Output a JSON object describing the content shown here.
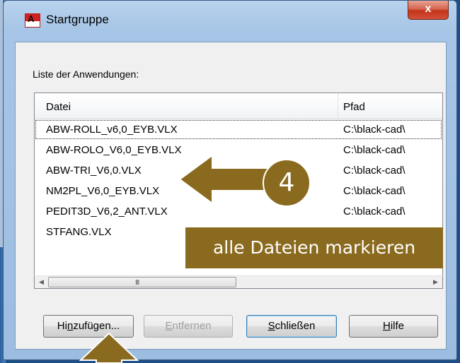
{
  "window": {
    "title": "Startgruppe",
    "app_icon_letter": "A",
    "close_label": "x"
  },
  "list_label": "Liste der Anwendungen:",
  "listview": {
    "columns": [
      "Datei",
      "Pfad"
    ],
    "rows": [
      {
        "name": "ABW-ROLL_v6,0_EYB.VLX",
        "path": "C:\\black-cad\\"
      },
      {
        "name": "ABW-ROLO_V6,0_EYB.VLX",
        "path": "C:\\black-cad\\"
      },
      {
        "name": "ABW-TRI_V6,0.VLX",
        "path": "C:\\black-cad\\"
      },
      {
        "name": "NM2PL_V6,0_EYB.VLX",
        "path": "C:\\black-cad\\"
      },
      {
        "name": "PEDIT3D_V6,2_ANT.VLX",
        "path": "C:\\black-cad\\"
      },
      {
        "name": "STFANG.VLX",
        "path": ""
      }
    ],
    "scroll_grip": "III"
  },
  "buttons": {
    "add": {
      "pre": "Hi",
      "mn": "n",
      "post": "zufügen..."
    },
    "remove": {
      "pre": "",
      "mn": "E",
      "post": "ntfernen"
    },
    "close": {
      "pre": "",
      "mn": "S",
      "post": "chließen"
    },
    "help": {
      "pre": "",
      "mn": "H",
      "post": "ilfe"
    }
  },
  "annotation": {
    "step_number": "4",
    "callout_text": "alle Dateien markieren",
    "color": "#8a6a1e"
  }
}
